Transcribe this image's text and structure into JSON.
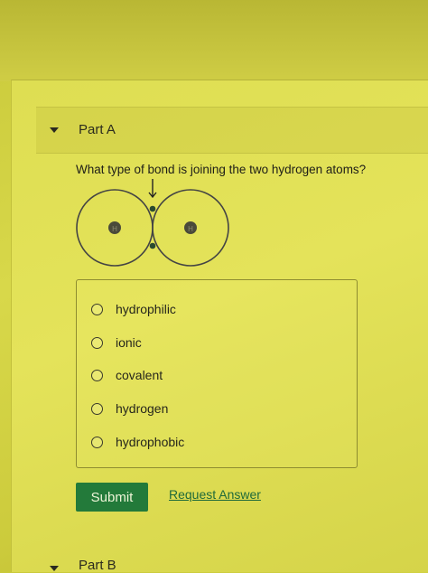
{
  "partA": {
    "title": "Part A"
  },
  "question": {
    "text": "What type of bond is joining the two hydrogen atoms?"
  },
  "diagram": {
    "atom_left_label": "H",
    "atom_right_label": "H"
  },
  "options": [
    "hydrophilic",
    "ionic",
    "covalent",
    "hydrogen",
    "hydrophobic"
  ],
  "actions": {
    "submit_label": "Submit",
    "request_label": "Request Answer"
  },
  "partB": {
    "title": "Part B"
  },
  "colors": {
    "submit_bg": "#237a3a",
    "link": "#1f6a3a",
    "background": "#d8d84a"
  }
}
